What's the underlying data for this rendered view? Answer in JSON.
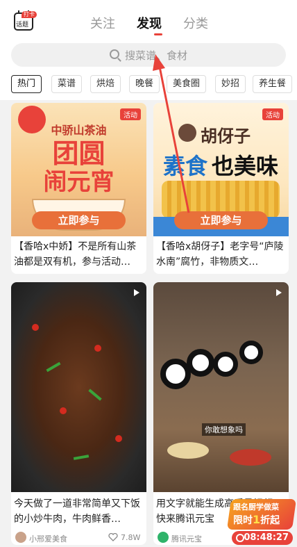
{
  "header": {
    "topic_icon_label": "话题",
    "checkin_badge": "打卡",
    "tabs": [
      "关注",
      "发现",
      "分类"
    ],
    "active_tab": "发现"
  },
  "search": {
    "placeholder": "搜菜谱、食材"
  },
  "chips": [
    "热门",
    "菜谱",
    "烘焙",
    "晚餐",
    "美食圈",
    "妙招",
    "养生餐"
  ],
  "cards": [
    {
      "badge": "活动",
      "poster_brand": "中骄山茶油",
      "poster_headline_1": "团圆",
      "poster_headline_2": "闹元宵",
      "cta": "立即参与",
      "title": "【香哈x中娇】不是所有山茶油都是双有机，参与活动…"
    },
    {
      "badge": "活动",
      "poster_brand": "胡伢子",
      "poster_headline_1": "素食",
      "poster_headline_2": "也美味",
      "cta": "立即参与",
      "title": "【香哈x胡伢子】老字号“庐陵水南”腐竹，非物质文…"
    },
    {
      "title": "今天做了一道非常简单又下饭的小炒牛肉，牛肉鲜香…",
      "author": "小邢爱美食",
      "likes": "7.8W"
    },
    {
      "overlay_text": "你敢想象吗",
      "title": "用文字就能生成高质量视频，快来腾讯元宝",
      "author": "腾讯元宝"
    }
  ],
  "promo": {
    "line1": "跟名厨学做菜",
    "line2_a": "限时",
    "line2_b": "1",
    "line2_c": "折起",
    "timer": "08:48:27"
  },
  "colors": {
    "accent": "#e8423a",
    "chip_border": "#dddddd"
  }
}
